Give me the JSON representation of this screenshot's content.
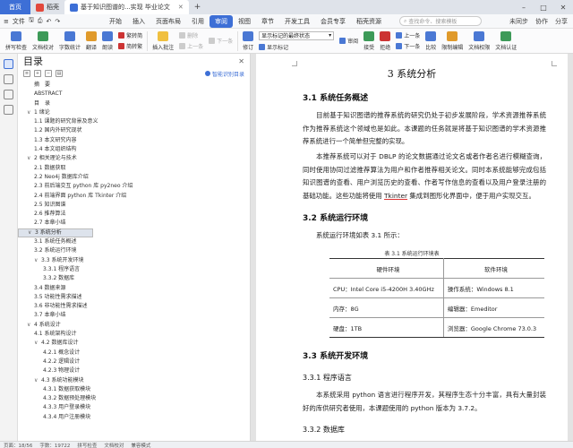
{
  "tabs": {
    "home": "首页",
    "items": [
      {
        "label": "稻壳",
        "color": "#e2483c"
      },
      {
        "label": "基于知识图谱的...实现 毕业论文",
        "color": "#3d6fd6"
      }
    ],
    "plus": "+"
  },
  "window_controls": [
    "–",
    "□",
    "✕"
  ],
  "menu": {
    "file": "文件",
    "items": [
      "开始",
      "插入",
      "页面布局",
      "引用",
      "审阅",
      "视图",
      "章节",
      "开发工具",
      "会员专享",
      "稻壳资源"
    ],
    "active_index": 4,
    "search_placeholder": "查找命令、搜索模板",
    "right": [
      "未同步",
      "协作",
      "分享"
    ]
  },
  "ribbon": {
    "big_buttons": [
      {
        "label": "拼写检查",
        "color": "#4a78d4"
      },
      {
        "label": "文档校对",
        "color": "#3d9a58"
      },
      {
        "label": "字数统计",
        "color": "#4a78d4"
      },
      {
        "label": "翻译",
        "color": "#e09a2b"
      },
      {
        "label": "朗读",
        "color": "#4a78d4"
      }
    ],
    "col1": [
      "繁转简",
      "简转繁"
    ],
    "insert_comment": "插入批注",
    "col2": [
      "删除",
      "上一条",
      "下一条"
    ],
    "track_changes": "修订",
    "display_mode": "显示标记的最终状态",
    "show_markup": "显示标记",
    "col3": [
      "审阅"
    ],
    "accept": "接受",
    "reject": "拒绝",
    "col4": [
      "上一条",
      "下一条"
    ],
    "compare": "比较",
    "restrict": "限制编辑",
    "doc_rights": "文档权限",
    "doc_verify": "文档认证"
  },
  "toc": {
    "title": "目录",
    "smart_toc": "智能识别目录",
    "tool_icons": [
      "≡",
      "+",
      "−",
      "▤"
    ],
    "items": [
      {
        "label": "摘　要",
        "level": 0
      },
      {
        "label": "ABSTRACT",
        "level": 0
      },
      {
        "label": "目　录",
        "level": 0
      },
      {
        "label": "1 绪论",
        "level": 1,
        "caret": "∨"
      },
      {
        "label": "1.1 课题的研究背景及意义",
        "level": 2
      },
      {
        "label": "1.2 国内外研究现状",
        "level": 2
      },
      {
        "label": "1.3 本文研究内容",
        "level": 2
      },
      {
        "label": "1.4 本文组织结构",
        "level": 2
      },
      {
        "label": "2 相关理论与技术",
        "level": 1,
        "caret": "∨"
      },
      {
        "label": "2.1 数据获取",
        "level": 2
      },
      {
        "label": "2.2 Neo4j 数据库介绍",
        "level": 2
      },
      {
        "label": "2.3 前后端交互 python 库 py2neo 介绍",
        "level": 2
      },
      {
        "label": "2.4 前端界面 python 库 Tkinter 介绍",
        "level": 2
      },
      {
        "label": "2.5 知识图谱",
        "level": 2
      },
      {
        "label": "2.6 推荐算法",
        "level": 2
      },
      {
        "label": "2.7 本章小结",
        "level": 2
      },
      {
        "label": "3 系统分析",
        "level": 1,
        "caret": "∨",
        "selected": true
      },
      {
        "label": "3.1 系统任务概述",
        "level": 2
      },
      {
        "label": "3.2 系统运行环境",
        "level": 2
      },
      {
        "label": "3.3 系统开发环境",
        "level": 2,
        "caret": "∨"
      },
      {
        "label": "3.3.1 程序语言",
        "level": 3
      },
      {
        "label": "3.3.2 数据库",
        "level": 3
      },
      {
        "label": "3.4 数据来源",
        "level": 2
      },
      {
        "label": "3.5 功能性需求描述",
        "level": 2
      },
      {
        "label": "3.6 非功能性需求描述",
        "level": 2
      },
      {
        "label": "3.7 本章小结",
        "level": 2
      },
      {
        "label": "4 系统设计",
        "level": 1,
        "caret": "∨"
      },
      {
        "label": "4.1 系统架构设计",
        "level": 2
      },
      {
        "label": "4.2 数据库设计",
        "level": 2,
        "caret": "∨"
      },
      {
        "label": "4.2.1 概念设计",
        "level": 3
      },
      {
        "label": "4.2.2 逻辑设计",
        "level": 3
      },
      {
        "label": "4.2.3 物理设计",
        "level": 3
      },
      {
        "label": "4.3 系统功能模块",
        "level": 2,
        "caret": "∨"
      },
      {
        "label": "4.3.1 数据获取模块",
        "level": 3
      },
      {
        "label": "4.3.2 数据预处理模块",
        "level": 3
      },
      {
        "label": "4.3.3 用户登录模块",
        "level": 3
      },
      {
        "label": "4.3.4 用户注册模块",
        "level": 3
      }
    ]
  },
  "doc": {
    "chapter": "3  系统分析",
    "h_3_1": "3.1  系统任务概述",
    "p1": "目前基于知识图谱的推荐系统的研究仍处于初步发展阶段，学术资源推荐系统作为推荐系统这个领域也是如此。本课题的任务就是将基于知识图谱的学术资源推荐系统进行一个简单但完整的实现。",
    "p2a": "本推荐系统可以对于 DBLP 的论文数据通过论文名或者作者名进行模糊查询，同时使用协同过滤推荐算法为用户和作者推荐相关论文。同时本系统能够完成包括知识图谱的查看、用户浏览历史的查看、作者写作信息的查看以及用户登录注册的基础功能。这些功能将使用 ",
    "p2u": "Tkinter",
    "p2b": " 集成到图形化界面中，便于用户实现交互。",
    "h_3_2": "3.2  系统运行环境",
    "p3": "系统运行环境如表 3.1 所示：",
    "table_caption": "表 3.1 系统运行环境表",
    "table_headers": [
      "硬件环境",
      "软件环境"
    ],
    "table_rows": [
      [
        "CPU：Intel Core i5-4200H 3.40GHz",
        "操作系统：Windows 8.1"
      ],
      [
        "内存：8G",
        "编辑器：Emeditor"
      ],
      [
        "硬盘：1TB",
        "浏览器：Google Chrome 73.0.3"
      ]
    ],
    "h_3_3": "3.3  系统开发环境",
    "h_3_3_1": "3.3.1  程序语言",
    "p4": "本系统采用 python 语言进行程序开发，其程序生态十分丰富，具有大量封装好的库供研究者使用，本课题使用的 python 版本为 3.7.2。",
    "h_3_3_2": "3.3.2  数据库"
  },
  "status": [
    "页面：18/56",
    "字数：19722",
    "拼写检查",
    "文档校对",
    "兼容模式"
  ]
}
